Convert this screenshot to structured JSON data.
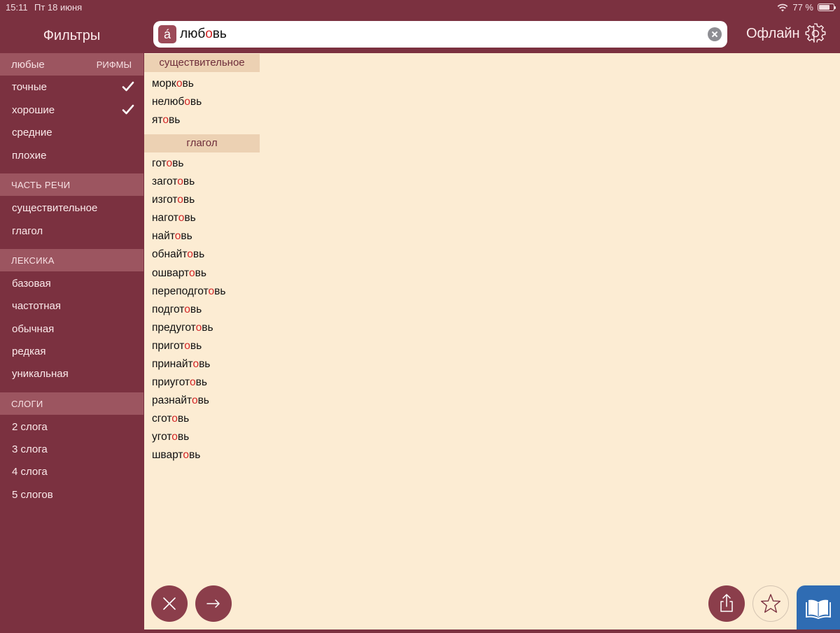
{
  "status_bar": {
    "time": "15:11",
    "date": "Пт 18 июня",
    "battery": "77 %",
    "battery_level": 0.77
  },
  "sidebar": {
    "title": "Фильтры",
    "rhyme_header": {
      "left": "любые",
      "right": "РИФМЫ"
    },
    "rhyme_items": [
      {
        "label": "точные",
        "checked": true
      },
      {
        "label": "хорошие",
        "checked": true
      },
      {
        "label": "средние",
        "checked": false
      },
      {
        "label": "плохие",
        "checked": false
      }
    ],
    "pos_header": "ЧАСТЬ РЕЧИ",
    "pos_items": [
      "существительное",
      "глагол"
    ],
    "lexicon_header": "ЛЕКСИКА",
    "lexicon_items": [
      "базовая",
      "частотная",
      "обычная",
      "редкая",
      "уникальная"
    ],
    "syllables_header": "СЛОГИ",
    "syllables_items": [
      "2 слога",
      "3 слога",
      "4 слога",
      "5 слогов"
    ]
  },
  "search": {
    "accent_button": "á",
    "value_before": "люб",
    "value_stress": "о",
    "value_after": "вь"
  },
  "header": {
    "offline_label": "Офлайн"
  },
  "results": {
    "groups": [
      {
        "header": "существительное",
        "words": [
          {
            "pre": "морк",
            "stress": "о",
            "post": "вь"
          },
          {
            "pre": "нелюб",
            "stress": "о",
            "post": "вь"
          },
          {
            "pre": "ят",
            "stress": "о",
            "post": "вь"
          }
        ]
      },
      {
        "header": "глагол",
        "words": [
          {
            "pre": "гот",
            "stress": "о",
            "post": "вь"
          },
          {
            "pre": "загот",
            "stress": "о",
            "post": "вь"
          },
          {
            "pre": "изгот",
            "stress": "о",
            "post": "вь"
          },
          {
            "pre": "нагот",
            "stress": "о",
            "post": "вь"
          },
          {
            "pre": "найт",
            "stress": "о",
            "post": "вь"
          },
          {
            "pre": "обнайт",
            "stress": "о",
            "post": "вь"
          },
          {
            "pre": "ошварт",
            "stress": "о",
            "post": "вь"
          },
          {
            "pre": "переподгот",
            "stress": "о",
            "post": "вь"
          },
          {
            "pre": "подгот",
            "stress": "о",
            "post": "вь"
          },
          {
            "pre": "предугот",
            "stress": "о",
            "post": "вь"
          },
          {
            "pre": "пригот",
            "stress": "о",
            "post": "вь"
          },
          {
            "pre": "принайт",
            "stress": "о",
            "post": "вь"
          },
          {
            "pre": "приугот",
            "stress": "о",
            "post": "вь"
          },
          {
            "pre": "разнайт",
            "stress": "о",
            "post": "вь"
          },
          {
            "pre": "сгот",
            "stress": "о",
            "post": "вь"
          },
          {
            "pre": "угот",
            "stress": "о",
            "post": "вь"
          },
          {
            "pre": "шварт",
            "stress": "о",
            "post": "вь"
          }
        ]
      }
    ]
  },
  "icons": {
    "close": "close-icon",
    "next": "arrow-right-icon",
    "share": "share-icon",
    "favorite": "star-icon",
    "dictionary": "book-icon",
    "settings": "gear-icon"
  },
  "colors": {
    "accent": "#7b3140",
    "stress": "#d32626",
    "background": "#fcecd3",
    "dictionary_button": "#2f6cb3"
  }
}
